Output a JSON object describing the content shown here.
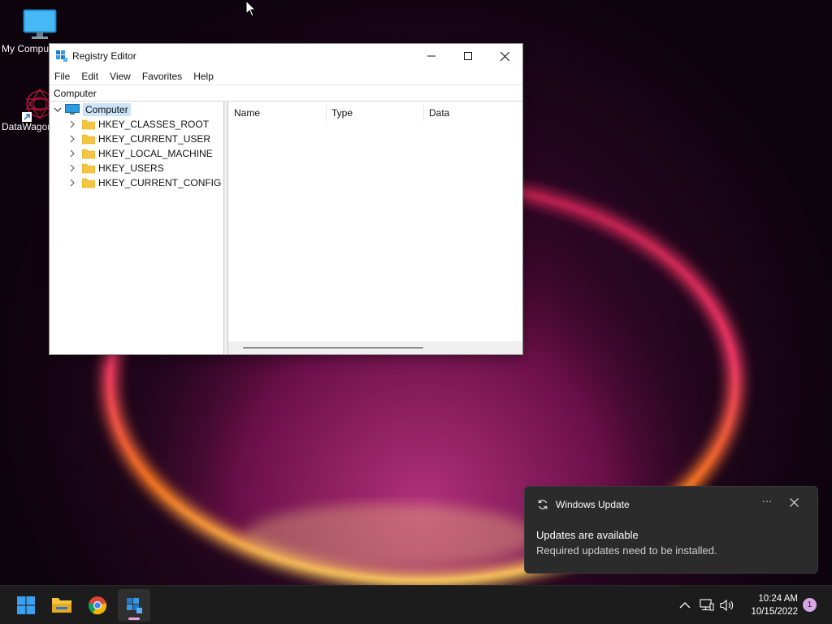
{
  "desktop": {
    "icons": [
      {
        "label": "My Computer",
        "icon": "monitor-icon"
      },
      {
        "label": "DataWagon",
        "icon": "datawagon-app-icon"
      }
    ]
  },
  "window": {
    "title": "Registry Editor",
    "menu": [
      "File",
      "Edit",
      "View",
      "Favorites",
      "Help"
    ],
    "address": "Computer",
    "tree": {
      "root": "Computer",
      "children": [
        "HKEY_CLASSES_ROOT",
        "HKEY_CURRENT_USER",
        "HKEY_LOCAL_MACHINE",
        "HKEY_USERS",
        "HKEY_CURRENT_CONFIG"
      ]
    },
    "columns": [
      "Name",
      "Type",
      "Data"
    ]
  },
  "toast": {
    "app": "Windows Update",
    "more": "···",
    "heading": "Updates are available",
    "body": "Required updates need to be installed."
  },
  "taskbar": {
    "apps": [
      "start-icon",
      "file-explorer-icon",
      "chrome-icon",
      "registry-editor-icon"
    ],
    "time": "10:24 AM",
    "date": "10/15/2022",
    "notification_count": "1"
  },
  "colors": {
    "accent": "#0078d4",
    "selection": "#cce4f7",
    "taskbar": "#1c1c1c",
    "toast": "#2b2b2b",
    "badge": "#d8a6e4"
  }
}
